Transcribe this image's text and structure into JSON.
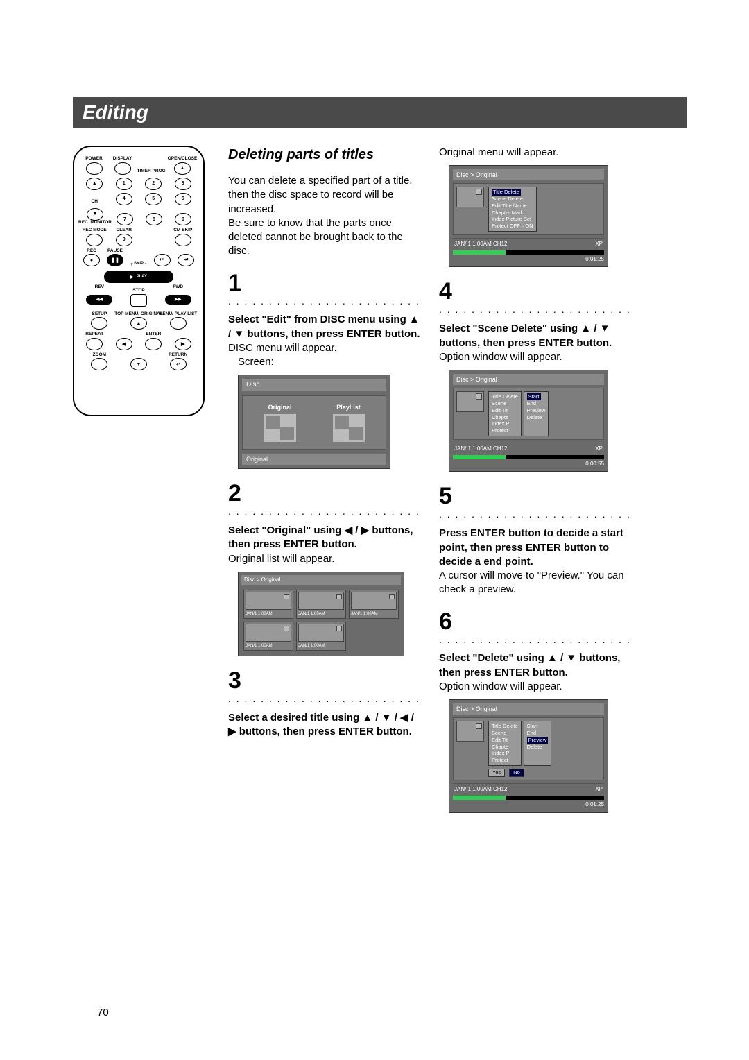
{
  "page_number": "70",
  "header": "Editing",
  "remote": {
    "labels": {
      "power": "POWER",
      "display": "DISPLAY",
      "timer": "TIMER PROG.",
      "open": "OPEN/CLOSE",
      "ch": "CH",
      "rec_mon": "REC. MONITOR",
      "rec_mode": "REC MODE",
      "clear": "CLEAR",
      "cm_skip": "CM SKIP",
      "rec": "REC",
      "pause": "PAUSE",
      "skip": "SKIP",
      "play": "PLAY",
      "rev": "REV",
      "fwd": "FWD",
      "stop": "STOP",
      "setup": "SETUP",
      "top": "TOP MENU/ ORIGINAL",
      "menu": "MENU/ PLAY LIST",
      "repeat": "REPEAT",
      "enter": "ENTER",
      "zoom": "ZOOM",
      "return": "RETURN"
    },
    "nums": [
      "1",
      "2",
      "3",
      "4",
      "5",
      "6",
      "7",
      "8",
      "9",
      "0"
    ]
  },
  "section_title": "Deleting parts of titles",
  "intro": "You can delete a specified part of a title, then the disc space to record will be increased.\nBe sure to know that the parts once deleted cannot be brought back to the disc.",
  "steps": [
    {
      "num": "1",
      "bold": "Select \"Edit\" from DISC menu using ▲ / ▼ buttons, then press ENTER button.",
      "plain": "DISC menu will appear.",
      "screen_label": "Screen:"
    },
    {
      "num": "2",
      "bold": "Select \"Original\" using ◀ / ▶ buttons, then press ENTER button.",
      "plain": "Original list will appear."
    },
    {
      "num": "3",
      "bold": "Select a desired title using ▲ / ▼ / ◀ / ▶ buttons, then press ENTER button.",
      "plain_before": "Original menu will appear."
    },
    {
      "num": "4",
      "bold": "Select \"Scene Delete\" using ▲ / ▼ buttons, then press ENTER button.",
      "plain": "Option window will appear."
    },
    {
      "num": "5",
      "bold": "Press ENTER button to decide a start point, then press ENTER button to decide a end point.",
      "plain": "A cursor will move to \"Preview.\" You can check a preview."
    },
    {
      "num": "6",
      "bold": "Select \"Delete\" using ▲ / ▼ buttons, then press ENTER button.",
      "plain": "Option window will appear."
    }
  ],
  "disc_screen": {
    "title": "Disc",
    "item1": "Original",
    "item2": "PlayList",
    "status": "Original"
  },
  "orig_grid": {
    "title": "Disc > Original",
    "cap": "JAN/1  1:00AM"
  },
  "orig_menu": {
    "title": "Disc > Original",
    "items": [
      "Title Delete",
      "Scene Delete",
      "Edit Title Name",
      "Chapter Mark",
      "Index Picture Set",
      "Protect OFF→ON"
    ],
    "foot": "JAN/ 1   1:00AM  CH12",
    "mode": "XP",
    "time": "0:01:25"
  },
  "scene_menu": {
    "title": "Disc > Original",
    "left": [
      "Title Delete",
      "Scene",
      "Edit Tit",
      "Chapte",
      "Index P",
      "Protect"
    ],
    "sub": [
      "Start",
      "End",
      "Preview",
      "Delete"
    ],
    "foot": "JAN/ 1   1:00AM  CH12",
    "mode": "XP",
    "time": "0:00:55"
  },
  "confirm_menu": {
    "title": "Disc > Original",
    "left": [
      "Title Delete",
      "Scene",
      "Edit Tit",
      "Chapte",
      "Index P",
      "Protect"
    ],
    "sub": [
      "Start",
      "End",
      "Preview",
      "Delete"
    ],
    "yes": "Yes",
    "no": "No",
    "foot": "JAN/ 1   1:00AM  CH12",
    "mode": "XP",
    "time": "0:01:25"
  }
}
